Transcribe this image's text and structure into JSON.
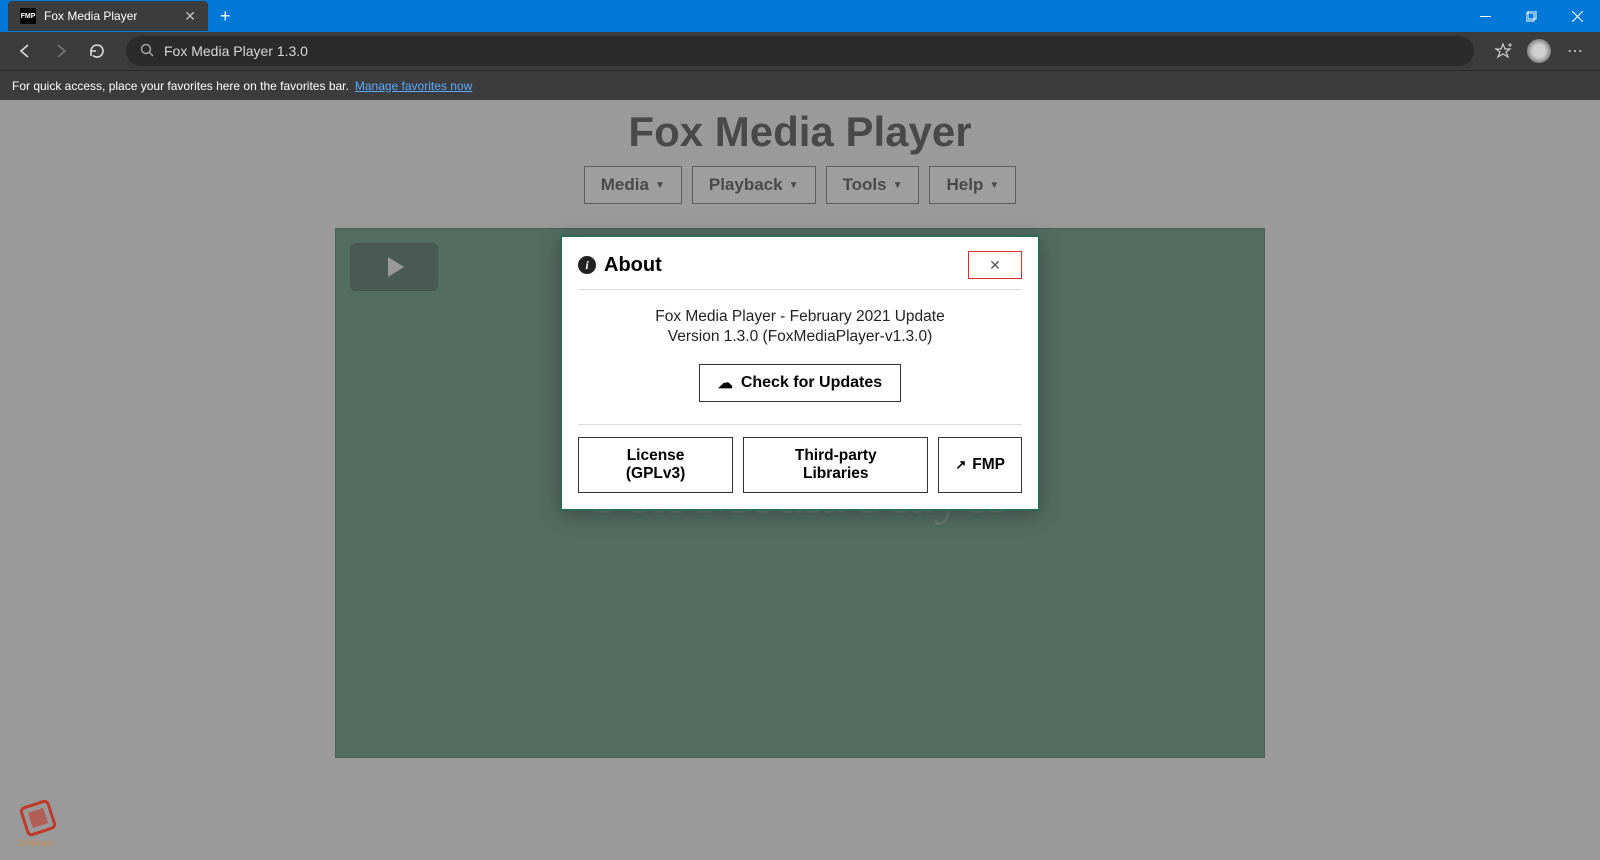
{
  "browser": {
    "tab_title": "Fox Media Player",
    "favicon_text": "FMP",
    "addressbar": "Fox Media Player 1.3.0",
    "favbar_hint": "For quick access, place your favorites here on the favorites bar.",
    "favbar_link": "Manage favorites now"
  },
  "app": {
    "title": "Fox Media Player",
    "menu": {
      "media": "Media",
      "playback": "Playback",
      "tools": "Tools",
      "help": "Help"
    },
    "watermark": "Fox Media Player"
  },
  "modal": {
    "title": "About",
    "line1": "Fox Media Player - February 2021 Update",
    "line2": "Version 1.3.0 (FoxMediaPlayer-v1.3.0)",
    "check_updates": "Check for Updates",
    "license": "License (GPLv3)",
    "third_party": "Third-party Libraries",
    "fmp": "FMP"
  }
}
